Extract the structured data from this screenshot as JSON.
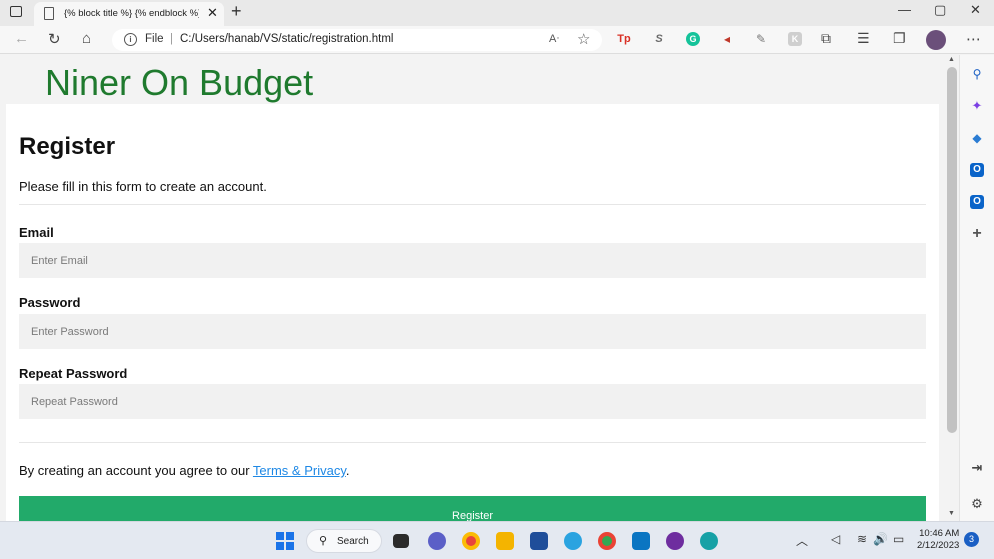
{
  "browser": {
    "tab_title": "{% block title %} {% endblock %}",
    "tab_close": "✕",
    "new_tab": "+",
    "url_scheme_label": "File",
    "url_separator": "|",
    "url": "C:/Users/hanab/VS/static/registration.html",
    "read_aloud": "A))",
    "window_controls": [
      "—",
      "▢",
      "✕"
    ],
    "nav_icons": [
      "←",
      "↻",
      "⌂"
    ],
    "more": "⋯",
    "extensions": [
      {
        "label": "Tp",
        "color": "#d93025"
      },
      {
        "label": "S",
        "color": "#6b6b6b"
      },
      {
        "label": "G",
        "color": "#15c39a"
      },
      {
        "label": "◂",
        "color": "#c0392b"
      },
      {
        "label": "✎",
        "color": "#777777"
      },
      {
        "label": "K",
        "color": "#aaaaaa"
      }
    ]
  },
  "page": {
    "brand": "Niner On Budget",
    "heading": "Register",
    "subtitle": "Please fill in this form to create an account.",
    "fields": [
      {
        "label": "Email",
        "placeholder": "Enter Email"
      },
      {
        "label": "Password",
        "placeholder": "Enter Password"
      },
      {
        "label": "Repeat Password",
        "placeholder": "Repeat Password"
      }
    ],
    "terms_prefix": "By creating an account you agree to our ",
    "terms_link": "Terms & Privacy",
    "terms_suffix": ".",
    "register_button": "Register"
  },
  "sidebar": {
    "icons": [
      {
        "name": "search-icon",
        "glyph": "🔍",
        "color": "#1a5fc4"
      },
      {
        "name": "copilot-icon",
        "glyph": "✦",
        "color": "#7b3fe4"
      },
      {
        "name": "office-icon",
        "glyph": "◆",
        "color": "#2b7cd3"
      },
      {
        "name": "outlook-icon",
        "glyph": "O",
        "color": "#0a64c9"
      },
      {
        "name": "outlook2-icon",
        "glyph": "O",
        "color": "#0a64c9"
      },
      {
        "name": "add-icon",
        "glyph": "+",
        "color": "#555555"
      }
    ],
    "bottom_icons": [
      "⇥",
      "⚙"
    ]
  },
  "taskbar": {
    "search_label": "Search",
    "time": "10:46 AM",
    "date": "2/12/2023",
    "notifications": "3",
    "tray": [
      "︿",
      "◁",
      "≋",
      "🔊",
      "▭"
    ]
  }
}
